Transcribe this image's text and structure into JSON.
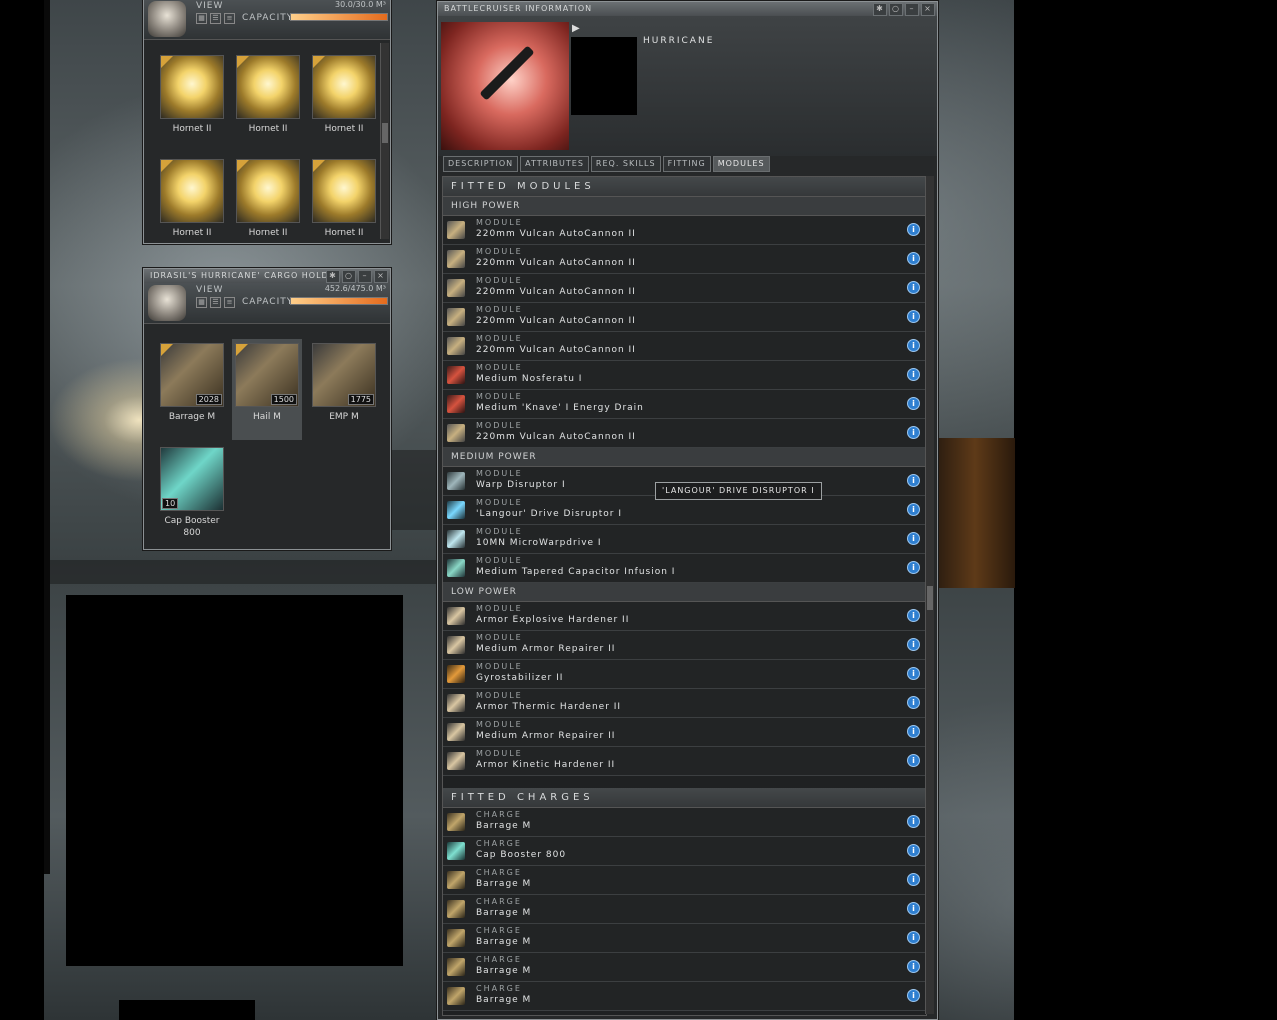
{
  "drone_bay": {
    "view_label": "VIEW",
    "capacity_label": "CAPACITY",
    "capacity_value": "30.0/30.0 M³",
    "capacity_fill": 1.0,
    "items": [
      {
        "label": "Hornet II"
      },
      {
        "label": "Hornet II"
      },
      {
        "label": "Hornet II"
      },
      {
        "label": "Hornet II"
      },
      {
        "label": "Hornet II"
      },
      {
        "label": "Hornet II"
      }
    ]
  },
  "cargo_hold": {
    "title": "IDRASIL'S HURRICANE' CARGO HOLD",
    "view_label": "VIEW",
    "capacity_label": "CAPACITY",
    "capacity_value": "452.6/475.0 M³",
    "capacity_fill": 0.95,
    "items": [
      {
        "label": "Barrage M",
        "qty": "2028"
      },
      {
        "label": "Hail M",
        "qty": "1500"
      },
      {
        "label": "EMP M",
        "qty": "1775"
      },
      {
        "label": "Cap Booster 800",
        "qty": "10"
      }
    ]
  },
  "info_window": {
    "title": "BATTLECRUISER INFORMATION",
    "ship_name": "HURRICANE",
    "tabs": [
      "DESCRIPTION",
      "ATTRIBUTES",
      "REQ. SKILLS",
      "FITTING",
      "MODULES"
    ],
    "active_tab": "MODULES",
    "fitted_modules_header": "FITTED MODULES",
    "high_power_label": "HIGH POWER",
    "medium_power_label": "MEDIUM POWER",
    "low_power_label": "LOW POWER",
    "fitted_charges_header": "FITTED CHARGES",
    "module_kind": "MODULE",
    "charge_kind": "CHARGE",
    "high": [
      {
        "name": "220mm Vulcan AutoCannon II",
        "icon": "autocannon-icon"
      },
      {
        "name": "220mm Vulcan AutoCannon II",
        "icon": "autocannon-icon"
      },
      {
        "name": "220mm Vulcan AutoCannon II",
        "icon": "autocannon-icon"
      },
      {
        "name": "220mm Vulcan AutoCannon II",
        "icon": "autocannon-icon"
      },
      {
        "name": "220mm Vulcan AutoCannon II",
        "icon": "autocannon-icon"
      },
      {
        "name": "Medium Nosferatu I",
        "icon": "nosferatu-icon"
      },
      {
        "name": "Medium 'Knave' I Energy Drain",
        "icon": "energy-drain-icon"
      },
      {
        "name": "220mm Vulcan AutoCannon II",
        "icon": "autocannon-icon"
      }
    ],
    "medium": [
      {
        "name": "Warp Disruptor I",
        "icon": "warp-disruptor-icon"
      },
      {
        "name": "'Langour' Drive Disruptor I",
        "icon": "drive-disruptor-icon"
      },
      {
        "name": "10MN MicroWarpdrive I",
        "icon": "microwarpdrive-icon"
      },
      {
        "name": "Medium Tapered Capacitor Infusion I",
        "icon": "capacitor-injector-icon"
      }
    ],
    "low": [
      {
        "name": "Armor Explosive Hardener II",
        "icon": "armor-hardener-icon"
      },
      {
        "name": "Medium Armor Repairer II",
        "icon": "armor-repairer-icon"
      },
      {
        "name": "Gyrostabilizer II",
        "icon": "gyrostabilizer-icon"
      },
      {
        "name": "Armor Thermic Hardener II",
        "icon": "armor-hardener-icon"
      },
      {
        "name": "Medium Armor Repairer II",
        "icon": "armor-repairer-icon"
      },
      {
        "name": "Armor Kinetic Hardener II",
        "icon": "armor-hardener-icon"
      }
    ],
    "charges": [
      {
        "name": "Barrage M",
        "icon": "ammo-icon"
      },
      {
        "name": "Cap Booster 800",
        "icon": "cap-booster-icon"
      },
      {
        "name": "Barrage M",
        "icon": "ammo-icon"
      },
      {
        "name": "Barrage M",
        "icon": "ammo-icon"
      },
      {
        "name": "Barrage M",
        "icon": "ammo-icon"
      },
      {
        "name": "Barrage M",
        "icon": "ammo-icon"
      },
      {
        "name": "Barrage M",
        "icon": "ammo-icon"
      }
    ],
    "tooltip": "'LANGOUR' DRIVE DISRUPTOR I"
  }
}
